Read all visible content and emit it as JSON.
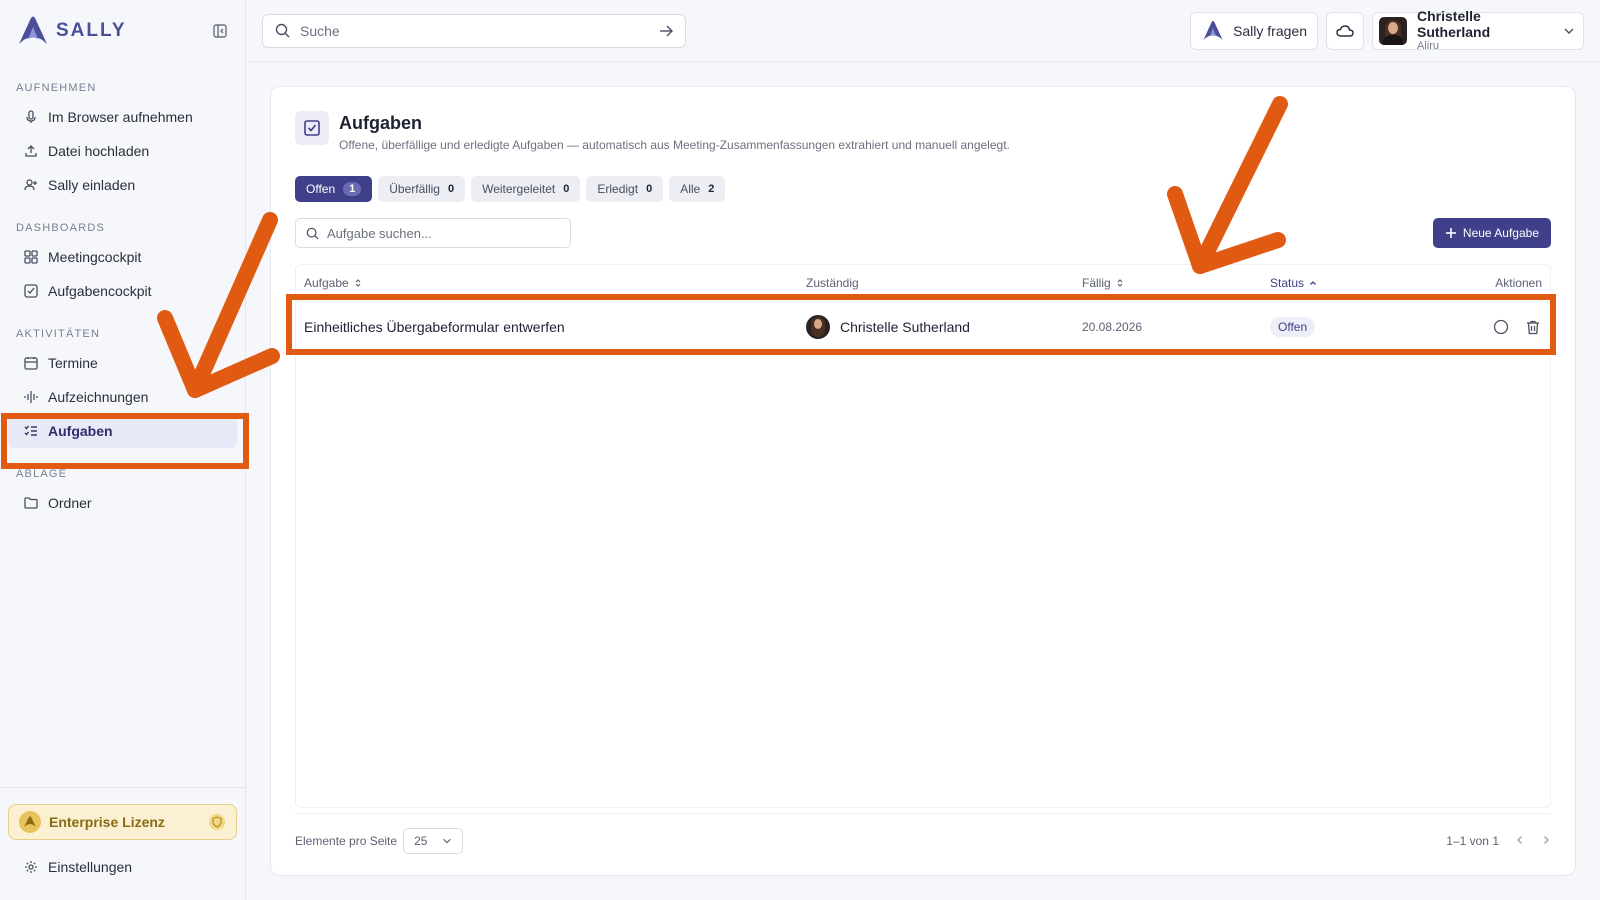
{
  "brand": {
    "name": "SALLY",
    "color": "#4a4f9a"
  },
  "sidebar": {
    "sections": [
      {
        "label": "AUFNEHMEN",
        "items": [
          {
            "label": "Im Browser aufnehmen",
            "icon": "microphone-icon"
          },
          {
            "label": "Datei hochladen",
            "icon": "upload-icon"
          },
          {
            "label": "Sally einladen",
            "icon": "user-plus-icon"
          }
        ]
      },
      {
        "label": "DASHBOARDS",
        "items": [
          {
            "label": "Meetingcockpit",
            "icon": "grid-icon"
          },
          {
            "label": "Aufgabencockpit",
            "icon": "checkbox-icon"
          }
        ]
      },
      {
        "label": "AKTIVITÄTEN",
        "items": [
          {
            "label": "Termine",
            "icon": "calendar-icon"
          },
          {
            "label": "Aufzeichnungen",
            "icon": "waveform-icon"
          },
          {
            "label": "Aufgaben",
            "icon": "task-list-icon",
            "active": true
          }
        ]
      },
      {
        "label": "ABLAGE",
        "items": [
          {
            "label": "Ordner",
            "icon": "folder-icon"
          }
        ]
      }
    ],
    "license": "Enterprise Lizenz",
    "settings": "Einstellungen"
  },
  "topbar": {
    "search_placeholder": "Suche",
    "ask_label": "Sally fragen",
    "user": {
      "name": "Christelle Sutherland",
      "org": "Aliru"
    }
  },
  "page": {
    "title": "Aufgaben",
    "subtitle": "Offene, überfällige und erledigte Aufgaben — automatisch aus Meeting-Zusammenfassungen extrahiert und manuell angelegt.",
    "tabs": [
      {
        "label": "Offen",
        "count": "1",
        "active": true
      },
      {
        "label": "Überfällig",
        "count": "0"
      },
      {
        "label": "Weitergeleitet",
        "count": "0"
      },
      {
        "label": "Erledigt",
        "count": "0"
      },
      {
        "label": "Alle",
        "count": "2"
      }
    ],
    "task_search_placeholder": "Aufgabe suchen...",
    "new_task_label": "Neue Aufgabe"
  },
  "table": {
    "headers": {
      "task": "Aufgabe",
      "assignee": "Zuständig",
      "due": "Fällig",
      "status": "Status",
      "actions": "Aktionen"
    },
    "rows": [
      {
        "task": "Einheitliches Übergabeformular entwerfen",
        "assignee": "Christelle Sutherland",
        "due": "20.08.2026",
        "status": "Offen"
      }
    ]
  },
  "footer": {
    "per_page_label": "Elemente pro Seite",
    "per_page_value": "25",
    "range": "1–1 von 1"
  },
  "colors": {
    "accent": "#3f3f8a",
    "annotation": "#e05a12",
    "license_bg": "#fbf1d2"
  }
}
